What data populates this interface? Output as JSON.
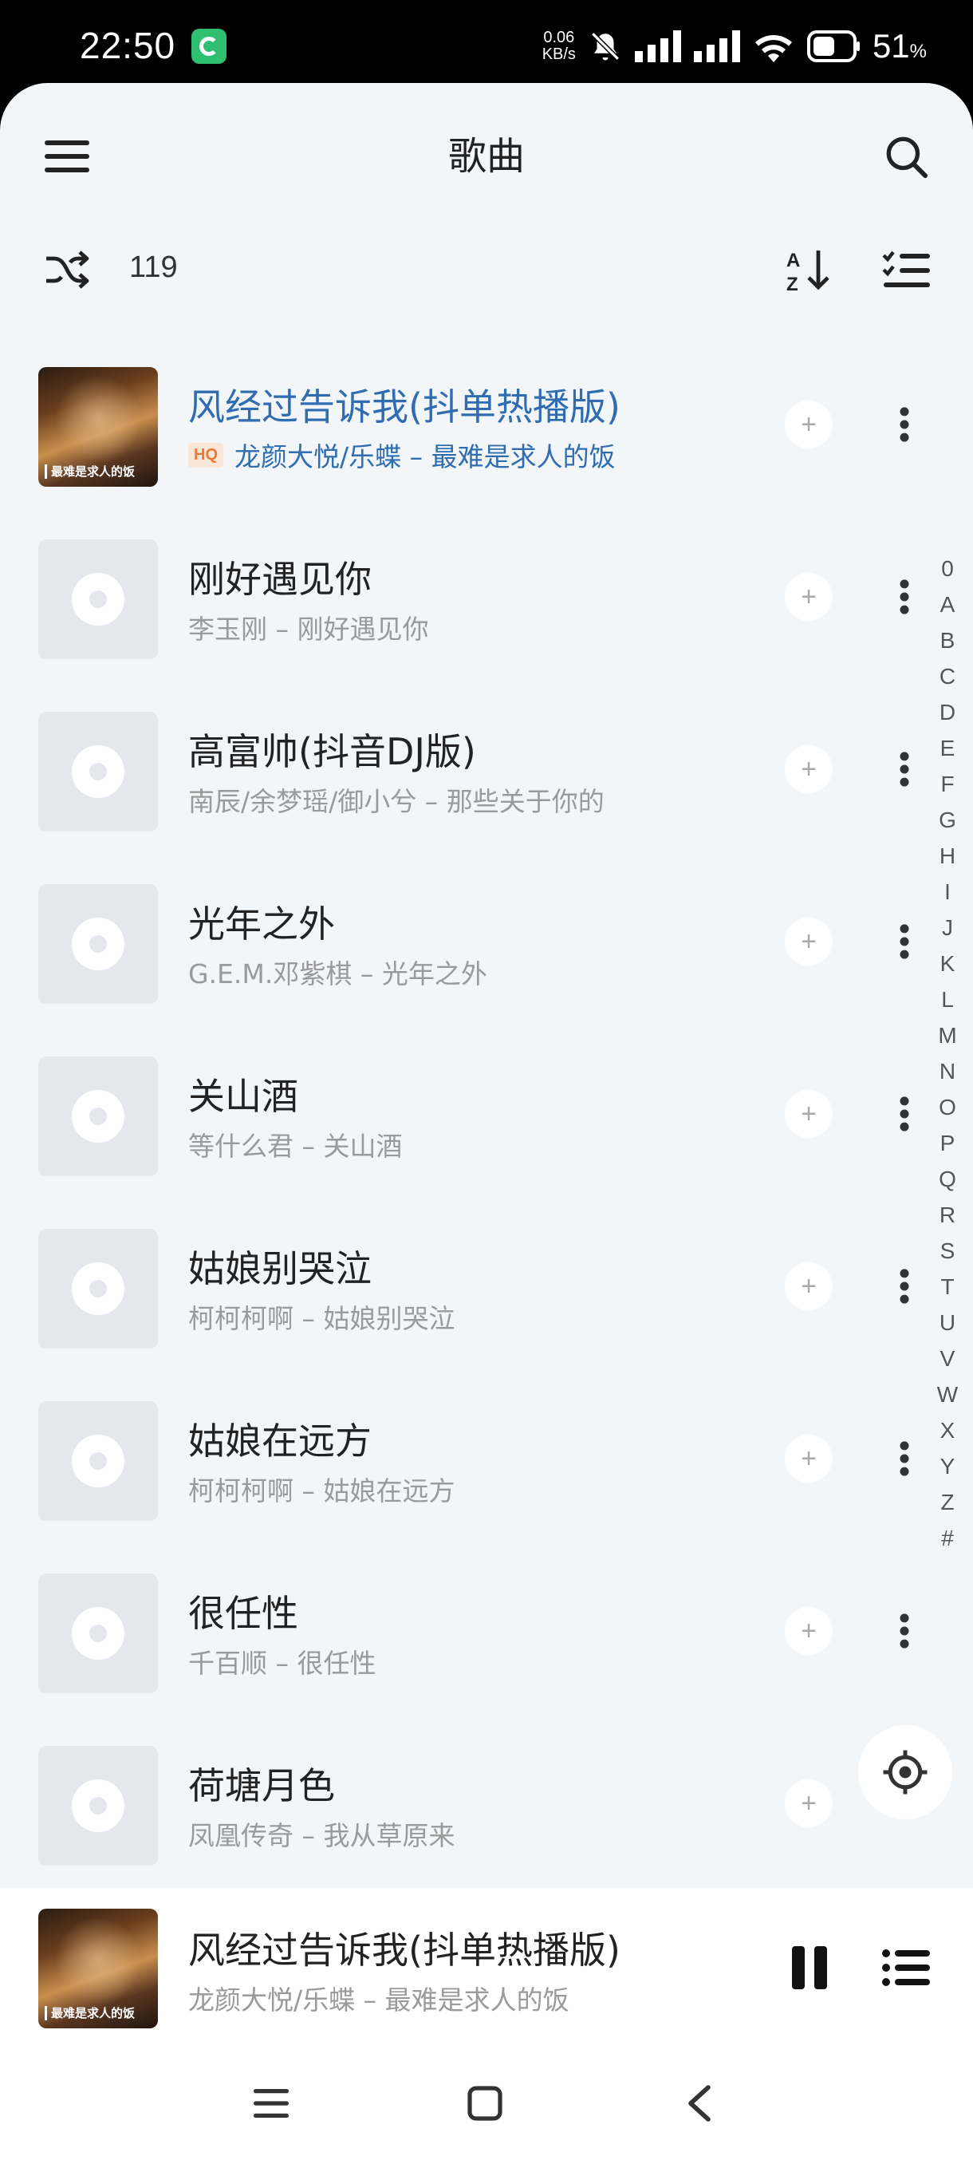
{
  "status_bar": {
    "time": "22:50",
    "net_speed_value": "0.06",
    "net_speed_unit": "KB/s",
    "battery_percent": "51",
    "battery_unit": "%"
  },
  "header": {
    "title": "歌曲"
  },
  "toolbar": {
    "song_count": "119"
  },
  "songs": [
    {
      "title": "风经过告诉我(抖单热播版)",
      "badge": "HQ",
      "subtitle": "龙颜大悦/乐蝶 – 最难是求人的饭",
      "cover_caption": "最难是求人的饭",
      "playing": true
    },
    {
      "title": "刚好遇见你",
      "subtitle": "李玉刚 – 刚好遇见你"
    },
    {
      "title": "高富帅(抖音DJ版)",
      "subtitle": "南辰/余梦瑶/御小兮 – 那些关于你的"
    },
    {
      "title": "光年之外",
      "subtitle": "G.E.M.邓紫棋 – 光年之外"
    },
    {
      "title": "关山酒",
      "subtitle": "等什么君 – 关山酒"
    },
    {
      "title": "姑娘别哭泣",
      "subtitle": "柯柯柯啊 – 姑娘别哭泣"
    },
    {
      "title": "姑娘在远方",
      "subtitle": "柯柯柯啊 – 姑娘在远方"
    },
    {
      "title": "很任性",
      "subtitle": "千百顺 – 很任性"
    },
    {
      "title": "荷塘月色",
      "subtitle": "凤凰传奇 – 我从草原来"
    }
  ],
  "alphabet_index": [
    "0",
    "A",
    "B",
    "C",
    "D",
    "E",
    "F",
    "G",
    "H",
    "I",
    "J",
    "K",
    "L",
    "M",
    "N",
    "O",
    "P",
    "Q",
    "R",
    "S",
    "T",
    "U",
    "V",
    "W",
    "X",
    "Y",
    "Z",
    "#"
  ],
  "mini_player": {
    "title": "风经过告诉我(抖单热播版)",
    "subtitle": "龙颜大悦/乐蝶 – 最难是求人的饭",
    "cover_caption": "最难是求人的饭"
  },
  "colors": {
    "accent": "#2f6db0",
    "background": "#f3f6f9",
    "hq_badge_bg": "#fbe7d8",
    "hq_badge_text": "#e57a3c"
  }
}
